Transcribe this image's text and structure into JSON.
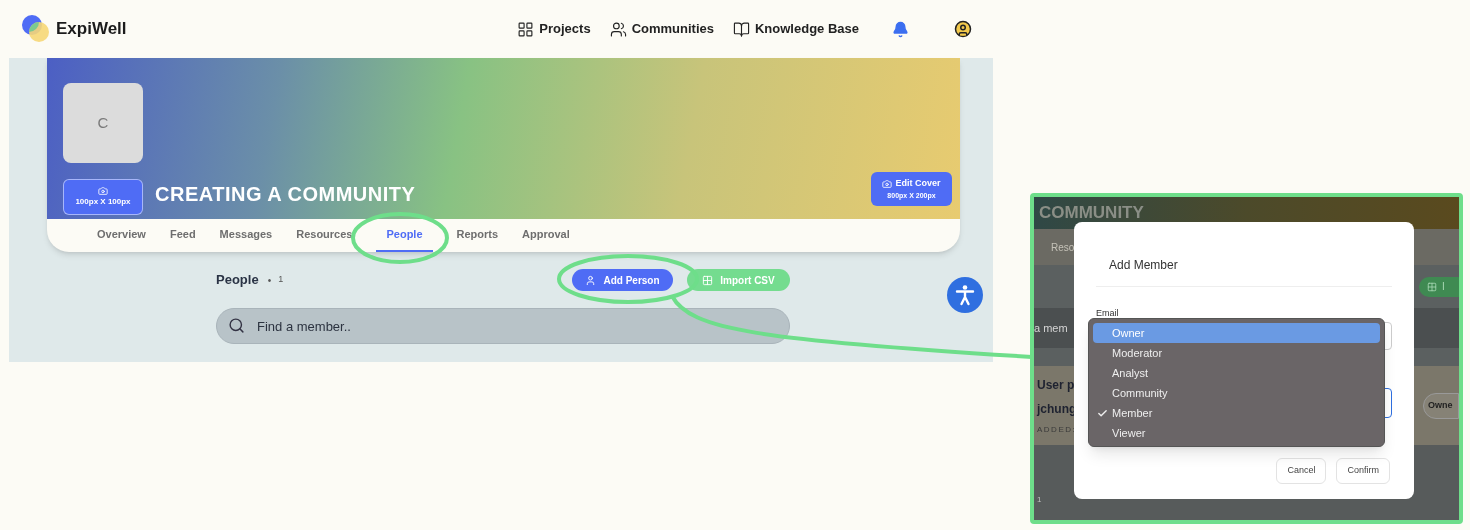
{
  "header": {
    "brand": "ExpiWell",
    "nav": [
      {
        "label": "Projects"
      },
      {
        "label": "Communities"
      },
      {
        "label": "Knowledge Base"
      }
    ]
  },
  "profile": {
    "avatar_letter": "C",
    "avatar_button": "100px X 100px",
    "title": "CREATING A COMMUNITY",
    "edit_cover": {
      "label": "Edit Cover",
      "size": "800px X 200px"
    }
  },
  "tabs": [
    {
      "label": "Overview",
      "selected": false
    },
    {
      "label": "Feed",
      "selected": false
    },
    {
      "label": "Messages",
      "selected": false
    },
    {
      "label": "Resources",
      "selected": false
    },
    {
      "label": "People",
      "selected": true
    },
    {
      "label": "Reports",
      "selected": false
    },
    {
      "label": "Approval",
      "selected": false
    }
  ],
  "people": {
    "heading": "People",
    "separator": "•",
    "count": "1",
    "add_button": "Add Person",
    "import_button": "Import CSV",
    "search": {
      "placeholder": "Find a member.."
    }
  },
  "inset": {
    "backdrop": {
      "title": "COMMUNITY",
      "tab": "Reso",
      "import_button": "I",
      "search": "a mem",
      "card_title": "User p",
      "user": "jchung",
      "added": "ADDED:",
      "role": "Owne",
      "page": "1"
    },
    "modal": {
      "title": "Add Member",
      "email_label": "Email",
      "options": [
        {
          "label": "Owner",
          "highlighted": true,
          "checked": false
        },
        {
          "label": "Moderator",
          "highlighted": false,
          "checked": false
        },
        {
          "label": "Analyst",
          "highlighted": false,
          "checked": false
        },
        {
          "label": "Community",
          "highlighted": false,
          "checked": false
        },
        {
          "label": "Member",
          "highlighted": false,
          "checked": true
        },
        {
          "label": "Viewer",
          "highlighted": false,
          "checked": false
        }
      ],
      "buttons": [
        "Cancel",
        "Confirm"
      ]
    }
  }
}
